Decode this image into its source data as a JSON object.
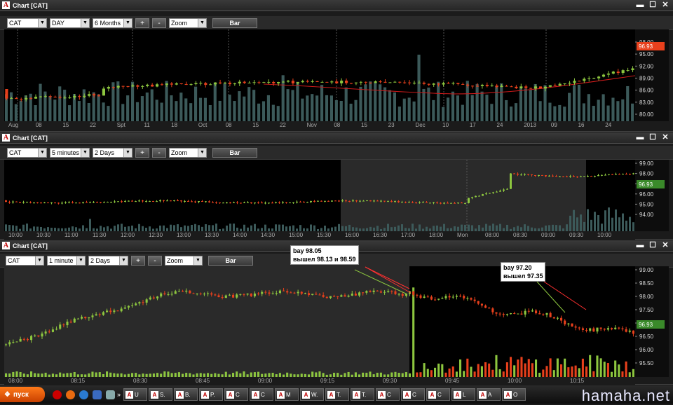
{
  "app": {
    "title": "Chart [CAT]",
    "icon": "A"
  },
  "windows": [
    {
      "symbol": "CAT",
      "interval": "DAY",
      "range": "6 Months",
      "zoom": "Zoom",
      "style": "Bar",
      "y_ticks": [
        "98.00",
        "95.00",
        "92.00",
        "89.00",
        "86.00",
        "83.00",
        "80.00"
      ],
      "x_ticks": [
        "Aug",
        "08",
        "15",
        "22",
        "Spt",
        "11",
        "18",
        "Oct",
        "08",
        "15",
        "22",
        "Nov",
        "08",
        "15",
        "23",
        "Dec",
        "10",
        "17",
        "24",
        "2013",
        "09",
        "16",
        "24"
      ],
      "last_price": "96.93"
    },
    {
      "symbol": "CAT",
      "interval": "5 minutes",
      "range": "2 Days",
      "zoom": "Zoom",
      "style": "Bar",
      "y_ticks": [
        "99.00",
        "98.00",
        "97.00",
        "96.00",
        "95.00",
        "94.00"
      ],
      "x_ticks": [
        "10:00",
        "10:30",
        "11:00",
        "11:30",
        "12:00",
        "12:30",
        "13:00",
        "13:30",
        "14:00",
        "14:30",
        "15:00",
        "15:30",
        "16:00",
        "16:30",
        "17:00",
        "18:00",
        "Mon",
        "08:00",
        "08:30",
        "09:00",
        "09:30",
        "10:00"
      ],
      "last_price": "96.93"
    },
    {
      "symbol": "CAT",
      "interval": "1 minute",
      "range": "2 Days",
      "zoom": "Zoom",
      "style": "Bar",
      "y_ticks": [
        "99.00",
        "98.50",
        "98.00",
        "97.50",
        "97.00",
        "96.50",
        "96.00",
        "95.50"
      ],
      "x_ticks": [
        "08:00",
        "08:15",
        "08:30",
        "08:45",
        "09:00",
        "09:15",
        "09:30",
        "09:45",
        "10:00",
        "10:15"
      ],
      "last_price": "96.93",
      "annotations": [
        {
          "line1": "bay 98.05",
          "line2": "вышел 98.13 и 98.59"
        },
        {
          "line1": "bay 97.20",
          "line2": "вышел 97.35"
        }
      ]
    }
  ],
  "taskbar": {
    "start_label": "пуск",
    "tasks": [
      "U",
      "S.",
      "B.",
      "P.",
      "C",
      "C",
      "M",
      "W.",
      "T.",
      "T.",
      "C",
      "C",
      "C",
      "L",
      "A",
      "O"
    ]
  },
  "watermark": "hamaha.net",
  "colors": {
    "up": "#8dc63f",
    "down": "#e8401c",
    "ma": "#cc1a1a",
    "volume": "#3c5a5a",
    "badge": "#cc2020"
  }
}
